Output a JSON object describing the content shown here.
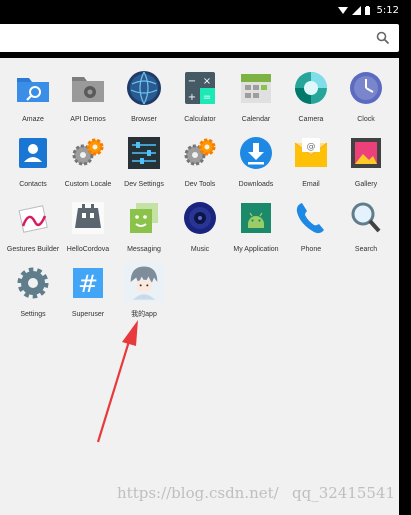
{
  "status_bar": {
    "time": "5:12"
  },
  "search": {
    "placeholder": ""
  },
  "apps": [
    {
      "label": "Amaze",
      "icon": "amaze-folder-icon"
    },
    {
      "label": "API Demos",
      "icon": "api-demos-folder-icon"
    },
    {
      "label": "Browser",
      "icon": "browser-globe-icon"
    },
    {
      "label": "Calculator",
      "icon": "calculator-icon"
    },
    {
      "label": "Calendar",
      "icon": "calendar-icon"
    },
    {
      "label": "Camera",
      "icon": "camera-icon"
    },
    {
      "label": "Clock",
      "icon": "clock-icon"
    },
    {
      "label": "Contacts",
      "icon": "contacts-icon"
    },
    {
      "label": "Custom Locale",
      "icon": "custom-locale-gear-icon"
    },
    {
      "label": "Dev Settings",
      "icon": "dev-settings-icon"
    },
    {
      "label": "Dev Tools",
      "icon": "dev-tools-gear-icon"
    },
    {
      "label": "Downloads",
      "icon": "downloads-icon"
    },
    {
      "label": "Email",
      "icon": "email-icon"
    },
    {
      "label": "Gallery",
      "icon": "gallery-icon"
    },
    {
      "label": "Gestures Builder",
      "icon": "gestures-builder-icon"
    },
    {
      "label": "HelloCordova",
      "icon": "cordova-robot-icon"
    },
    {
      "label": "Messaging",
      "icon": "messaging-icon"
    },
    {
      "label": "Music",
      "icon": "music-speaker-icon"
    },
    {
      "label": "My Application",
      "icon": "android-app-icon"
    },
    {
      "label": "Phone",
      "icon": "phone-icon"
    },
    {
      "label": "Search",
      "icon": "search-magnifier-icon"
    },
    {
      "label": "Settings",
      "icon": "settings-gear-icon"
    },
    {
      "label": "Superuser",
      "icon": "superuser-hash-icon"
    },
    {
      "label": "我的app",
      "icon": "anime-avatar-icon"
    }
  ],
  "watermark": {
    "text_left": "https://blog.csdn.net/",
    "text_right": "qq_32415541"
  },
  "colors": {
    "drawer_bg": "#f1f1f1",
    "arrow": "#e8393c"
  }
}
